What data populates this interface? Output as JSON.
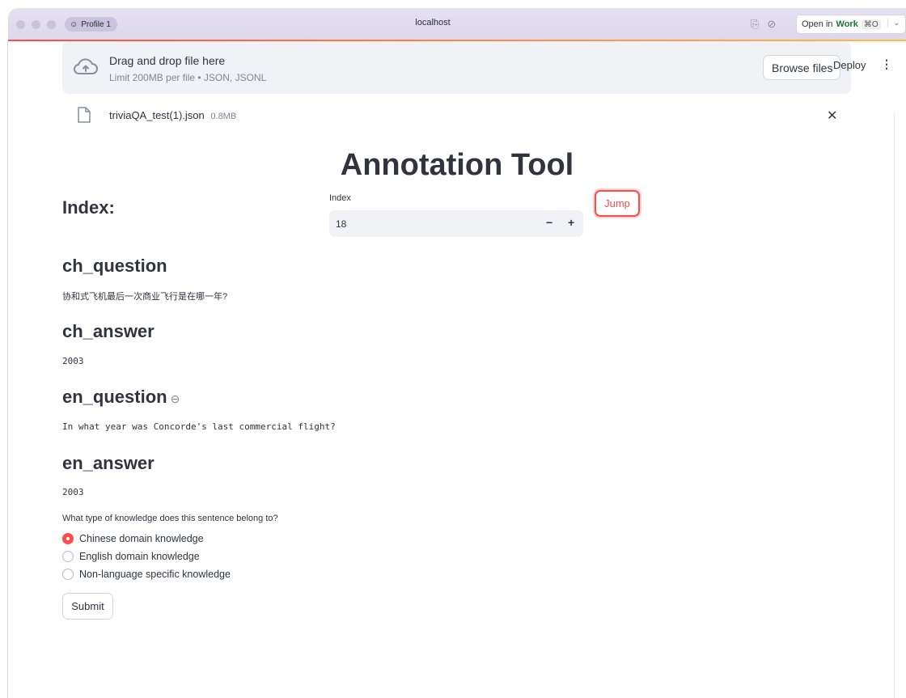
{
  "browser": {
    "profile_label": "Profile 1",
    "url": "localhost",
    "open_in_prefix": "Open in",
    "open_in_target": "Work",
    "open_in_shortcut": "⌘O"
  },
  "uploader": {
    "title": "Drag and drop file here",
    "subtitle": "Limit 200MB per file • JSON, JSONL",
    "browse_label": "Browse files"
  },
  "toolbar": {
    "deploy_label": "Deploy"
  },
  "file": {
    "name": "triviaQA_test(1).json",
    "size": "0.8MB"
  },
  "app": {
    "title": "Annotation Tool"
  },
  "index": {
    "heading": "Index:",
    "input_label": "Index",
    "value": "18",
    "jump_label": "Jump"
  },
  "sections": {
    "ch_question": {
      "heading": "ch_question",
      "text": "协和式飞机最后一次商业飞行是在哪一年?"
    },
    "ch_answer": {
      "heading": "ch_answer",
      "text": "2003"
    },
    "en_question": {
      "heading": "en_question",
      "text": "In what year was Concorde's last commercial flight?"
    },
    "en_answer": {
      "heading": "en_answer",
      "text": "2003"
    }
  },
  "knowledge": {
    "label": "What type of knowledge does this sentence belong to?",
    "options": [
      {
        "label": "Chinese domain knowledge",
        "selected": true
      },
      {
        "label": "English domain knowledge",
        "selected": false
      },
      {
        "label": "Non-language specific knowledge",
        "selected": false
      }
    ]
  },
  "submit_label": "Submit",
  "colors": {
    "accent": "#ff4b4b",
    "text": "#31333f",
    "muted": "#808495",
    "input_bg": "#f0f2f6"
  }
}
